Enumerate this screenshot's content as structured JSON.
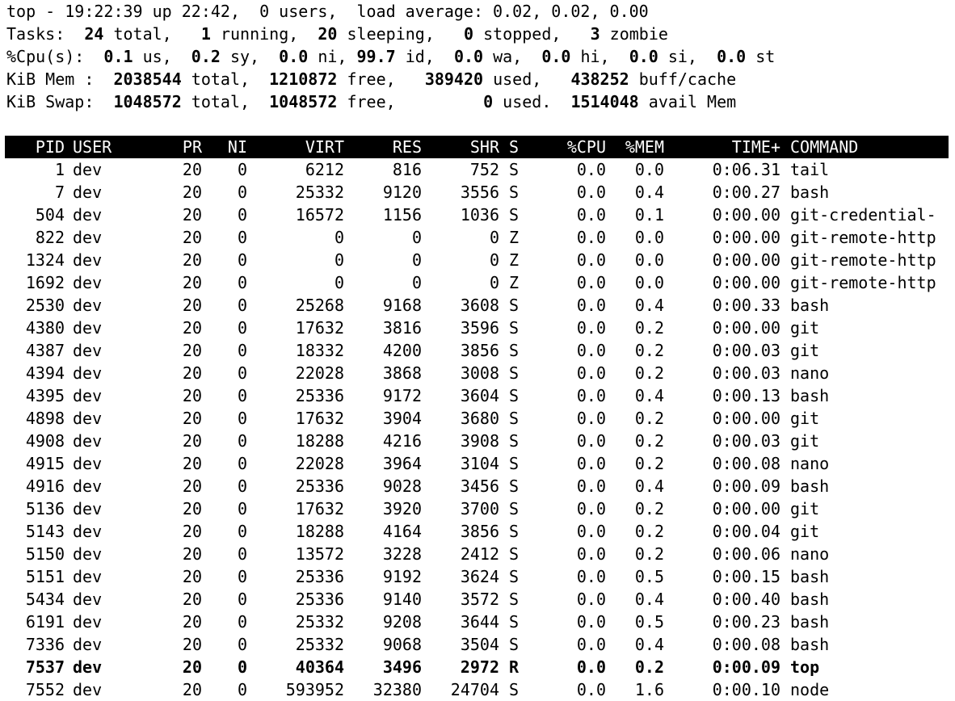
{
  "summary": {
    "line1": "top - 19:22:39 up 22:42,  0 users,  load average: 0.02, 0.02, 0.00",
    "tasks": {
      "label": "Tasks:",
      "total": "24",
      "total_label": " total,",
      "running": "1",
      "running_label": " running,",
      "sleeping": "20",
      "sleeping_label": " sleeping,",
      "stopped": "0",
      "stopped_label": " stopped,",
      "zombie": "3",
      "zombie_label": " zombie"
    },
    "cpu": {
      "label": "%Cpu(s):",
      "us": "0.1",
      "sy": "0.2",
      "ni": "0.0",
      "id": "99.7",
      "wa": "0.0",
      "hi": "0.0",
      "si": "0.0",
      "st": "0.0"
    },
    "mem": {
      "label": "KiB Mem :",
      "total": "2038544",
      "free": "1210872",
      "used": "389420",
      "buff_cache": "438252"
    },
    "swap": {
      "label": "KiB Swap:",
      "total": "1048572",
      "free": "1048572",
      "used": "0",
      "avail": "1514048"
    }
  },
  "columns": [
    "PID",
    "USER",
    "PR",
    "NI",
    "VIRT",
    "RES",
    "SHR",
    "S",
    "%CPU",
    "%MEM",
    "TIME+",
    "COMMAND"
  ],
  "processes": [
    {
      "pid": "1",
      "user": "dev",
      "pr": "20",
      "ni": "0",
      "virt": "6212",
      "res": "816",
      "shr": "752",
      "s": "S",
      "cpu": "0.0",
      "mem": "0.0",
      "time": "0:06.31",
      "cmd": "tail"
    },
    {
      "pid": "7",
      "user": "dev",
      "pr": "20",
      "ni": "0",
      "virt": "25332",
      "res": "9120",
      "shr": "3556",
      "s": "S",
      "cpu": "0.0",
      "mem": "0.4",
      "time": "0:00.27",
      "cmd": "bash"
    },
    {
      "pid": "504",
      "user": "dev",
      "pr": "20",
      "ni": "0",
      "virt": "16572",
      "res": "1156",
      "shr": "1036",
      "s": "S",
      "cpu": "0.0",
      "mem": "0.1",
      "time": "0:00.00",
      "cmd": "git-credential-"
    },
    {
      "pid": "822",
      "user": "dev",
      "pr": "20",
      "ni": "0",
      "virt": "0",
      "res": "0",
      "shr": "0",
      "s": "Z",
      "cpu": "0.0",
      "mem": "0.0",
      "time": "0:00.00",
      "cmd": "git-remote-http"
    },
    {
      "pid": "1324",
      "user": "dev",
      "pr": "20",
      "ni": "0",
      "virt": "0",
      "res": "0",
      "shr": "0",
      "s": "Z",
      "cpu": "0.0",
      "mem": "0.0",
      "time": "0:00.00",
      "cmd": "git-remote-http"
    },
    {
      "pid": "1692",
      "user": "dev",
      "pr": "20",
      "ni": "0",
      "virt": "0",
      "res": "0",
      "shr": "0",
      "s": "Z",
      "cpu": "0.0",
      "mem": "0.0",
      "time": "0:00.00",
      "cmd": "git-remote-http"
    },
    {
      "pid": "2530",
      "user": "dev",
      "pr": "20",
      "ni": "0",
      "virt": "25268",
      "res": "9168",
      "shr": "3608",
      "s": "S",
      "cpu": "0.0",
      "mem": "0.4",
      "time": "0:00.33",
      "cmd": "bash"
    },
    {
      "pid": "4380",
      "user": "dev",
      "pr": "20",
      "ni": "0",
      "virt": "17632",
      "res": "3816",
      "shr": "3596",
      "s": "S",
      "cpu": "0.0",
      "mem": "0.2",
      "time": "0:00.00",
      "cmd": "git"
    },
    {
      "pid": "4387",
      "user": "dev",
      "pr": "20",
      "ni": "0",
      "virt": "18332",
      "res": "4200",
      "shr": "3856",
      "s": "S",
      "cpu": "0.0",
      "mem": "0.2",
      "time": "0:00.03",
      "cmd": "git"
    },
    {
      "pid": "4394",
      "user": "dev",
      "pr": "20",
      "ni": "0",
      "virt": "22028",
      "res": "3868",
      "shr": "3008",
      "s": "S",
      "cpu": "0.0",
      "mem": "0.2",
      "time": "0:00.03",
      "cmd": "nano"
    },
    {
      "pid": "4395",
      "user": "dev",
      "pr": "20",
      "ni": "0",
      "virt": "25336",
      "res": "9172",
      "shr": "3604",
      "s": "S",
      "cpu": "0.0",
      "mem": "0.4",
      "time": "0:00.13",
      "cmd": "bash"
    },
    {
      "pid": "4898",
      "user": "dev",
      "pr": "20",
      "ni": "0",
      "virt": "17632",
      "res": "3904",
      "shr": "3680",
      "s": "S",
      "cpu": "0.0",
      "mem": "0.2",
      "time": "0:00.00",
      "cmd": "git"
    },
    {
      "pid": "4908",
      "user": "dev",
      "pr": "20",
      "ni": "0",
      "virt": "18288",
      "res": "4216",
      "shr": "3908",
      "s": "S",
      "cpu": "0.0",
      "mem": "0.2",
      "time": "0:00.03",
      "cmd": "git"
    },
    {
      "pid": "4915",
      "user": "dev",
      "pr": "20",
      "ni": "0",
      "virt": "22028",
      "res": "3964",
      "shr": "3104",
      "s": "S",
      "cpu": "0.0",
      "mem": "0.2",
      "time": "0:00.08",
      "cmd": "nano"
    },
    {
      "pid": "4916",
      "user": "dev",
      "pr": "20",
      "ni": "0",
      "virt": "25336",
      "res": "9028",
      "shr": "3456",
      "s": "S",
      "cpu": "0.0",
      "mem": "0.4",
      "time": "0:00.09",
      "cmd": "bash"
    },
    {
      "pid": "5136",
      "user": "dev",
      "pr": "20",
      "ni": "0",
      "virt": "17632",
      "res": "3920",
      "shr": "3700",
      "s": "S",
      "cpu": "0.0",
      "mem": "0.2",
      "time": "0:00.00",
      "cmd": "git"
    },
    {
      "pid": "5143",
      "user": "dev",
      "pr": "20",
      "ni": "0",
      "virt": "18288",
      "res": "4164",
      "shr": "3856",
      "s": "S",
      "cpu": "0.0",
      "mem": "0.2",
      "time": "0:00.04",
      "cmd": "git"
    },
    {
      "pid": "5150",
      "user": "dev",
      "pr": "20",
      "ni": "0",
      "virt": "13572",
      "res": "3228",
      "shr": "2412",
      "s": "S",
      "cpu": "0.0",
      "mem": "0.2",
      "time": "0:00.06",
      "cmd": "nano"
    },
    {
      "pid": "5151",
      "user": "dev",
      "pr": "20",
      "ni": "0",
      "virt": "25336",
      "res": "9192",
      "shr": "3624",
      "s": "S",
      "cpu": "0.0",
      "mem": "0.5",
      "time": "0:00.15",
      "cmd": "bash"
    },
    {
      "pid": "5434",
      "user": "dev",
      "pr": "20",
      "ni": "0",
      "virt": "25336",
      "res": "9140",
      "shr": "3572",
      "s": "S",
      "cpu": "0.0",
      "mem": "0.4",
      "time": "0:00.40",
      "cmd": "bash"
    },
    {
      "pid": "6191",
      "user": "dev",
      "pr": "20",
      "ni": "0",
      "virt": "25332",
      "res": "9208",
      "shr": "3644",
      "s": "S",
      "cpu": "0.0",
      "mem": "0.5",
      "time": "0:00.23",
      "cmd": "bash"
    },
    {
      "pid": "7336",
      "user": "dev",
      "pr": "20",
      "ni": "0",
      "virt": "25332",
      "res": "9068",
      "shr": "3504",
      "s": "S",
      "cpu": "0.0",
      "mem": "0.4",
      "time": "0:00.08",
      "cmd": "bash"
    },
    {
      "pid": "7537",
      "user": "dev",
      "pr": "20",
      "ni": "0",
      "virt": "40364",
      "res": "3496",
      "shr": "2972",
      "s": "R",
      "cpu": "0.0",
      "mem": "0.2",
      "time": "0:00.09",
      "cmd": "top"
    },
    {
      "pid": "7552",
      "user": "dev",
      "pr": "20",
      "ni": "0",
      "virt": "593952",
      "res": "32380",
      "shr": "24704",
      "s": "S",
      "cpu": "0.0",
      "mem": "1.6",
      "time": "0:00.10",
      "cmd": "node"
    }
  ]
}
